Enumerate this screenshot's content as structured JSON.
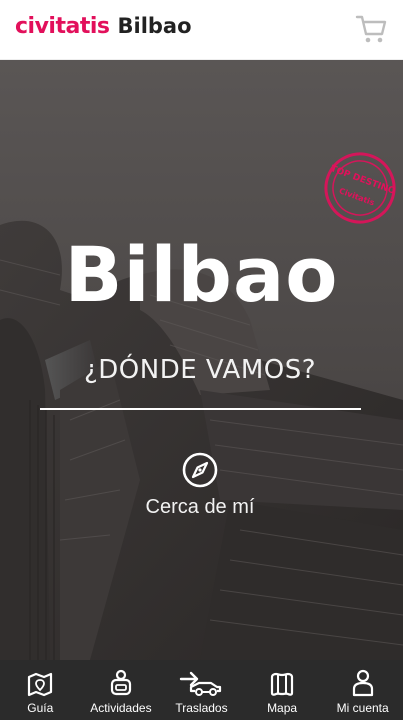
{
  "header": {
    "brand": "civitatis",
    "city": "Bilbao",
    "cart_icon": "cart-icon",
    "brand_color": "#e2105b"
  },
  "hero": {
    "title": "Bilbao",
    "stamp_top": "TOP DESTINO",
    "stamp_bottom": "Civitatis",
    "search_label": "¿DÓNDE VAMOS?",
    "near_me_label": "Cerca de mí",
    "near_me_icon": "compass-icon"
  },
  "tabbar": {
    "background": "#2b2b2b",
    "tabs": [
      {
        "label": "Guía",
        "icon": "guide-map-icon"
      },
      {
        "label": "Actividades",
        "icon": "activities-icon"
      },
      {
        "label": "Traslados",
        "icon": "transfer-car-icon"
      },
      {
        "label": "Mapa",
        "icon": "map-icon"
      },
      {
        "label": "Mi cuenta",
        "icon": "account-icon"
      }
    ]
  }
}
